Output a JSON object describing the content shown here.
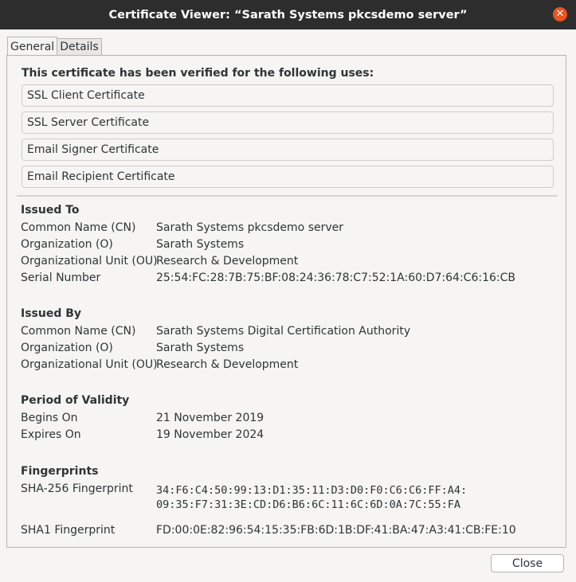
{
  "window": {
    "title": "Certificate Viewer: “Sarath Systems pkcsdemo server”",
    "close_glyph": "✕"
  },
  "tabs": [
    {
      "label": "General",
      "active": true
    },
    {
      "label": "Details",
      "active": false
    }
  ],
  "verified": {
    "heading": "This certificate has been verified for the following uses:",
    "uses": [
      "SSL Client Certificate",
      "SSL Server Certificate",
      "Email Signer Certificate",
      "Email Recipient Certificate"
    ]
  },
  "issued_to": {
    "heading": "Issued To",
    "rows": [
      {
        "label": "Common Name (CN)",
        "value": "Sarath Systems pkcsdemo server"
      },
      {
        "label": "Organization (O)",
        "value": "Sarath Systems"
      },
      {
        "label": "Organizational Unit (OU)",
        "value": "Research & Development"
      },
      {
        "label": "Serial Number",
        "value": "25:54:FC:28:7B:75:BF:08:24:36:78:C7:52:1A:60:D7:64:C6:16:CB"
      }
    ]
  },
  "issued_by": {
    "heading": "Issued By",
    "rows": [
      {
        "label": "Common Name (CN)",
        "value": "Sarath Systems Digital Certification Authority"
      },
      {
        "label": "Organization (O)",
        "value": "Sarath Systems"
      },
      {
        "label": "Organizational Unit (OU)",
        "value": "Research & Development"
      }
    ]
  },
  "validity": {
    "heading": "Period of Validity",
    "rows": [
      {
        "label": "Begins On",
        "value": "21 November 2019"
      },
      {
        "label": "Expires On",
        "value": "19 November 2024"
      }
    ]
  },
  "fingerprints": {
    "heading": "Fingerprints",
    "sha256_label": "SHA-256 Fingerprint",
    "sha256_line1": "34:F6:C4:50:99:13:D1:35:11:D3:D0:F0:C6:C6:FF:A4:",
    "sha256_line2": "09:35:F7:31:3E:CD:D6:B6:6C:11:6C:6D:0A:7C:55:FA",
    "sha1_label": "SHA1 Fingerprint",
    "sha1_value": "FD:00:0E:82:96:54:15:35:FB:6D:1B:DF:41:BA:47:A3:41:CB:FE:10"
  },
  "footer": {
    "close_label": "Close"
  }
}
